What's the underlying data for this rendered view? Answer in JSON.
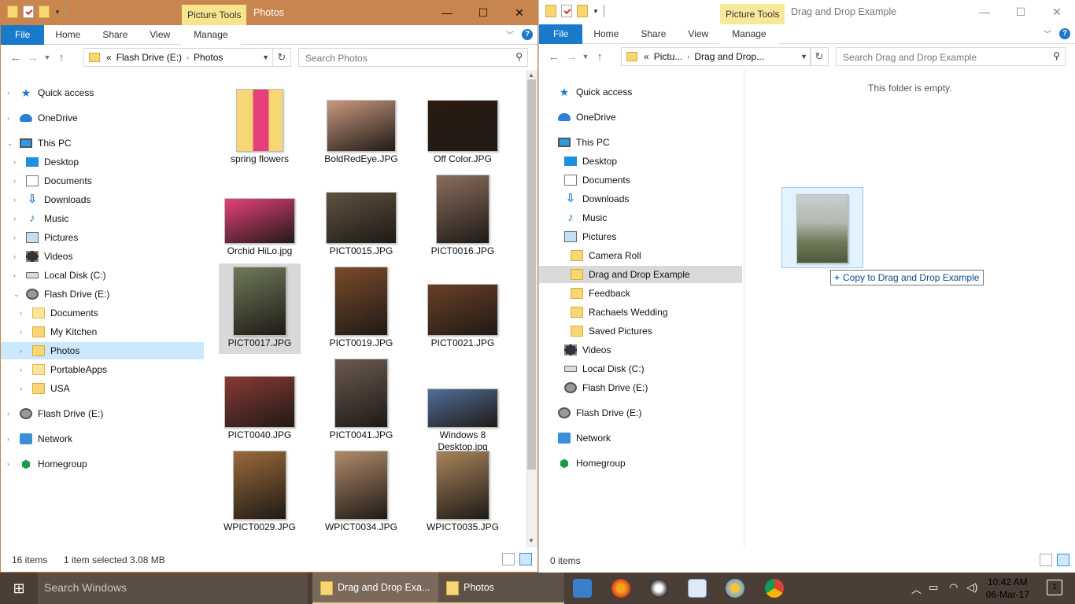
{
  "left": {
    "context_tab": "Picture Tools",
    "title": "Photos",
    "ribbon_tabs": [
      "File",
      "Home",
      "Share",
      "View",
      "Manage"
    ],
    "address": {
      "prefix": "«",
      "segments": [
        "Flash Drive (E:)",
        "Photos"
      ]
    },
    "search_placeholder": "Search Photos",
    "nav": [
      {
        "label": "Quick access",
        "icon": "star"
      },
      {
        "label": "OneDrive",
        "icon": "cloud"
      },
      {
        "label": "This PC",
        "icon": "pc"
      },
      {
        "label": "Desktop",
        "icon": "desk"
      },
      {
        "label": "Documents",
        "icon": "doc"
      },
      {
        "label": "Downloads",
        "icon": "dl"
      },
      {
        "label": "Music",
        "icon": "mus"
      },
      {
        "label": "Pictures",
        "icon": "pic"
      },
      {
        "label": "Videos",
        "icon": "vid"
      },
      {
        "label": "Local Disk (C:)",
        "icon": "disk"
      },
      {
        "label": "Flash Drive (E:)",
        "icon": "usb"
      },
      {
        "label": "Documents",
        "icon": "folderw"
      },
      {
        "label": "My Kitchen",
        "icon": "folder"
      },
      {
        "label": "Photos",
        "icon": "folder"
      },
      {
        "label": "PortableApps",
        "icon": "folderw"
      },
      {
        "label": "USA",
        "icon": "folder"
      },
      {
        "label": "Flash Drive (E:)",
        "icon": "usb"
      },
      {
        "label": "Network",
        "icon": "net"
      },
      {
        "label": "Homegroup",
        "icon": "home"
      }
    ],
    "files": [
      {
        "name": "spring flowers",
        "color": "#f7d774"
      },
      {
        "name": "BoldRedEye.JPG",
        "color": "#c9987f"
      },
      {
        "name": "Off Color.JPG",
        "color": "#2b1a10"
      },
      {
        "name": "Orchid HiLo.jpg",
        "color": "#e6407a"
      },
      {
        "name": "PICT0015.JPG",
        "color": "#5f5140"
      },
      {
        "name": "PICT0016.JPG",
        "color": "#8a6e5e"
      },
      {
        "name": "PICT0017.JPG",
        "color": "#6f7a5a"
      },
      {
        "name": "PICT0019.JPG",
        "color": "#7a4a2a"
      },
      {
        "name": "PICT0021.JPG",
        "color": "#6a3f26"
      },
      {
        "name": "PICT0040.JPG",
        "color": "#8a3a35"
      },
      {
        "name": "PICT0041.JPG",
        "color": "#6a5a50"
      },
      {
        "name": "Windows 8 Desktop.jpg",
        "color": "#4f6f9a"
      },
      {
        "name": "WPICT0029.JPG",
        "color": "#9a6a3a"
      },
      {
        "name": "WPICT0034.JPG",
        "color": "#b08a6a"
      },
      {
        "name": "WPICT0035.JPG",
        "color": "#a8845a"
      }
    ],
    "status": {
      "count": "16 items",
      "selection": "1 item selected  3.08 MB"
    }
  },
  "right": {
    "context_tab": "Picture Tools",
    "title": "Drag and Drop Example",
    "ribbon_tabs": [
      "File",
      "Home",
      "Share",
      "View",
      "Manage"
    ],
    "address": {
      "prefix": "«",
      "segments": [
        "Pictu...",
        "Drag and Drop..."
      ]
    },
    "search_placeholder": "Search Drag and Drop Example",
    "nav": [
      {
        "label": "Quick access",
        "icon": "star"
      },
      {
        "label": "OneDrive",
        "icon": "cloud"
      },
      {
        "label": "This PC",
        "icon": "pc"
      },
      {
        "label": "Desktop",
        "icon": "desk"
      },
      {
        "label": "Documents",
        "icon": "doc"
      },
      {
        "label": "Downloads",
        "icon": "dl"
      },
      {
        "label": "Music",
        "icon": "mus"
      },
      {
        "label": "Pictures",
        "icon": "pic"
      },
      {
        "label": "Camera Roll",
        "icon": "folder"
      },
      {
        "label": "Drag and Drop Example",
        "icon": "folder"
      },
      {
        "label": "Feedback",
        "icon": "folder"
      },
      {
        "label": "Rachaels Wedding",
        "icon": "folder"
      },
      {
        "label": "Saved Pictures",
        "icon": "folder"
      },
      {
        "label": "Videos",
        "icon": "vid"
      },
      {
        "label": "Local Disk (C:)",
        "icon": "disk"
      },
      {
        "label": "Flash Drive (E:)",
        "icon": "usb"
      },
      {
        "label": "Flash Drive (E:)",
        "icon": "usb"
      },
      {
        "label": "Network",
        "icon": "net"
      },
      {
        "label": "Homegroup",
        "icon": "home"
      }
    ],
    "empty_message": "This folder is empty.",
    "drag_tooltip": "Copy to Drag and Drop Example",
    "drag_tooltip_symbol": "+",
    "status": {
      "count": "0 items"
    }
  },
  "taskbar": {
    "search_placeholder": "Search Windows",
    "apps": [
      "Drag and Drop Exa...",
      "Photos"
    ],
    "time": "10:42 AM",
    "date": "06-Mar-17",
    "notifications": "1"
  }
}
